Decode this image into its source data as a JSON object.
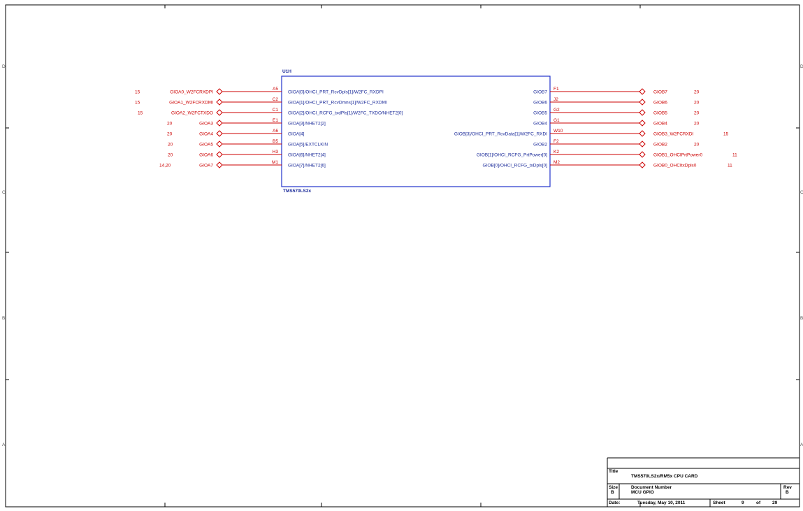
{
  "component": {
    "ref": "U1H",
    "part": "TMS570LS2x"
  },
  "left_pins": [
    {
      "pin": "A5",
      "name": "GIOA[0]/OHCI_PRT_RcvDpls[1]/W2FC_RXDPI",
      "net": "GIOA0_W2FCRXDPI",
      "sheet": "15"
    },
    {
      "pin": "C2",
      "name": "GIOA[1]/OHCI_PRT_RcvDmns[1]/W2FC_RXDMI",
      "net": "GIOA1_W2FCRXDMI",
      "sheet": "15"
    },
    {
      "pin": "C1",
      "name": "GIOA[2]/OHCI_RCFG_txdPls[1]/W2FC_TXDO/NHET2[0]",
      "net": "GIOA2_W2FCTXDO",
      "sheet": "15"
    },
    {
      "pin": "E1",
      "name": "GIOA[3]/NHET2[2]",
      "net": "GIOA3",
      "sheet": "20"
    },
    {
      "pin": "A6",
      "name": "GIOA[4]",
      "net": "GIOA4",
      "sheet": "20"
    },
    {
      "pin": "B5",
      "name": "GIOA[5]/EXTCLKIN",
      "net": "GIOA5",
      "sheet": "20"
    },
    {
      "pin": "H3",
      "name": "GIOA[6]/NHET2[4]",
      "net": "GIOA6",
      "sheet": "20"
    },
    {
      "pin": "M1",
      "name": "GIOA[7]/NHET2[6]",
      "net": "GIOA7",
      "sheet": "14,20"
    }
  ],
  "right_pins": [
    {
      "pin": "F1",
      "name": "GIOB7",
      "net": "GIOB7",
      "sheet": "20"
    },
    {
      "pin": "J2",
      "name": "GIOB6",
      "net": "GIOB6",
      "sheet": "20"
    },
    {
      "pin": "G2",
      "name": "GIOB5",
      "net": "GIOB5",
      "sheet": "20"
    },
    {
      "pin": "G1",
      "name": "GIOB4",
      "net": "GIOB4",
      "sheet": "20"
    },
    {
      "pin": "W10",
      "name": "GIOB[3]/OHCI_PRT_RcvData[1]/W2FC_RXDI",
      "net": "GIOB3_W2FCRXDI",
      "sheet": "15"
    },
    {
      "pin": "F2",
      "name": "GIOB2",
      "net": "GIOB2",
      "sheet": "20"
    },
    {
      "pin": "K2",
      "name": "GIOB[1]/OHCI_RCFG_PrtPower[0]",
      "net": "GIOB1_OHCIPrtPower0",
      "sheet": "11"
    },
    {
      "pin": "M2",
      "name": "GIOB[0]/OHCI_RCFG_txDpls[0]",
      "net": "GIOB0_OHCItxDpls0",
      "sheet": "11"
    }
  ],
  "border": {
    "rows_left": [
      "D",
      "C",
      "B",
      "A"
    ],
    "rows_right": [
      "D",
      "C",
      "B",
      "A"
    ]
  },
  "title_block": {
    "title_label": "Title",
    "title": "TMS570LS2x/RM5x CPU CARD",
    "size_label": "Size",
    "size": "B",
    "docnum_label": "Document Number",
    "docnum": "MCU GPIO",
    "rev_label": "Rev",
    "rev": "B",
    "date_label": "Date:",
    "date": "Tuesday, May 10, 2011",
    "sheet_label": "Sheet",
    "sheet": "9",
    "of_label": "of",
    "total": "29"
  },
  "colors": {
    "wire": "#cc0000",
    "body": "#2233cc",
    "text_blue": "#1a2a99",
    "frame": "#000000"
  }
}
